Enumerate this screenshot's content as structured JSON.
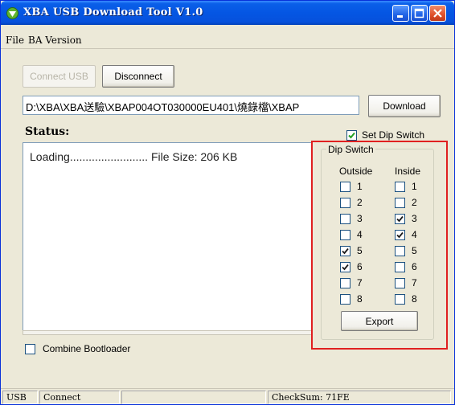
{
  "window": {
    "title": "XBA USB Download Tool V1.0"
  },
  "menu": {
    "file": "File",
    "ba_version": "BA Version"
  },
  "toolbar": {
    "connect_usb": "Connect USB",
    "disconnect": "Disconnect",
    "download": "Download"
  },
  "path": {
    "value": "D:\\XBA\\XBA送驗\\XBAP004OT030000EU401\\燒錄檔\\XBAP"
  },
  "status": {
    "label": "Status:",
    "message": "Loading......................... File Size: 206 KB"
  },
  "set_dip_switch": {
    "label": "Set Dip Switch",
    "checked": true
  },
  "dip_switch": {
    "legend": "Dip Switch",
    "outside_label": "Outside",
    "inside_label": "Inside",
    "outside": [
      {
        "num": "1",
        "checked": false
      },
      {
        "num": "2",
        "checked": false
      },
      {
        "num": "3",
        "checked": false
      },
      {
        "num": "4",
        "checked": false
      },
      {
        "num": "5",
        "checked": true
      },
      {
        "num": "6",
        "checked": true
      },
      {
        "num": "7",
        "checked": false
      },
      {
        "num": "8",
        "checked": false
      }
    ],
    "inside": [
      {
        "num": "1",
        "checked": false
      },
      {
        "num": "2",
        "checked": false
      },
      {
        "num": "3",
        "checked": true
      },
      {
        "num": "4",
        "checked": true
      },
      {
        "num": "5",
        "checked": false
      },
      {
        "num": "6",
        "checked": false
      },
      {
        "num": "7",
        "checked": false
      },
      {
        "num": "8",
        "checked": false
      }
    ],
    "export": "Export"
  },
  "combine_bootloader": {
    "label": "Combine Bootloader",
    "checked": false
  },
  "statusbar": {
    "usb": "USB",
    "connect": "Connect",
    "checksum": "CheckSum: 71FE"
  },
  "colors": {
    "title_bar": "#0556e3",
    "window_bg": "#ece9d8",
    "highlight_box": "#e02020"
  }
}
